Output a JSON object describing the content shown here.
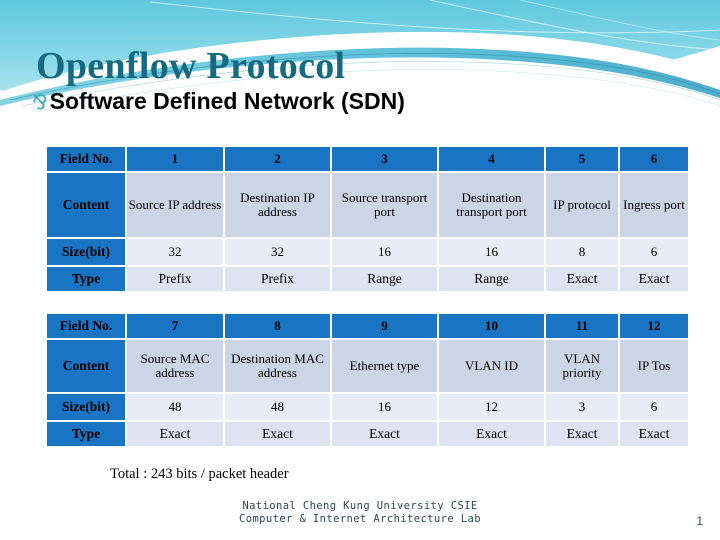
{
  "slide": {
    "title": "Openflow Protocol",
    "subtitle": "Software Defined Network (SDN)",
    "bullet_glyph": "⅋",
    "bullet_icon": "reversed-ampersand-bullet-icon",
    "title_color": "#156a80",
    "accent_color": "#1a74c4",
    "header_band_color": "#7fd3e4"
  },
  "table_top": {
    "row_labels": [
      "Field No.",
      "Content",
      "Size(bit)",
      "Type"
    ],
    "field_no": [
      "1",
      "2",
      "3",
      "4",
      "5",
      "6"
    ],
    "content": [
      "Source IP address",
      "Destination IP address",
      "Source transport port",
      "Destination transport port",
      "IP protocol",
      "Ingress port"
    ],
    "size_bit": [
      "32",
      "32",
      "16",
      "16",
      "8",
      "6"
    ],
    "type": [
      "Prefix",
      "Prefix",
      "Range",
      "Range",
      "Exact",
      "Exact"
    ]
  },
  "table_bottom": {
    "row_labels": [
      "Field No.",
      "Content",
      "Size(bit)",
      "Type"
    ],
    "field_no": [
      "7",
      "8",
      "9",
      "10",
      "11",
      "12"
    ],
    "content": [
      "Source MAC address",
      "Destination MAC address",
      "Ethernet type",
      "VLAN ID",
      "VLAN priority",
      "IP Tos"
    ],
    "size_bit": [
      "48",
      "48",
      "16",
      "12",
      "3",
      "6"
    ],
    "type": [
      "Exact",
      "Exact",
      "Exact",
      "Exact",
      "Exact",
      "Exact"
    ]
  },
  "total_line": "Total : 243 bits / packet header",
  "footer": {
    "line1": "National Cheng Kung University CSIE",
    "line2": "Computer & Internet Architecture Lab"
  },
  "page_number": "1"
}
